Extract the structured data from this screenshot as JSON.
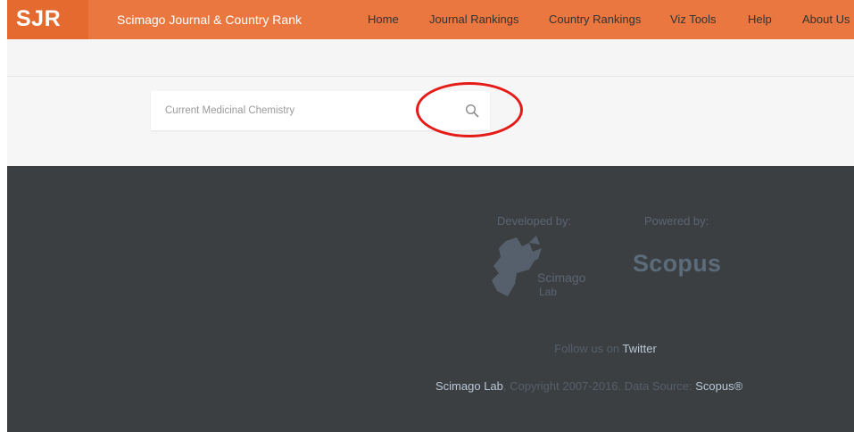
{
  "header": {
    "logo": "SJR",
    "title": "Scimago Journal & Country Rank"
  },
  "nav": {
    "items": [
      "Home",
      "Journal Rankings",
      "Country Rankings",
      "Viz Tools",
      "Help",
      "About Us"
    ]
  },
  "search": {
    "value": "",
    "placeholder": "Current Medicinal Chemistry",
    "button_icon": "search-icon"
  },
  "footer": {
    "developed_by": "Developed by:",
    "powered_by": "Powered by:",
    "scimago_logo_text": "Scimago",
    "scimago_logo_sub": "Lab",
    "scopus_logo_text": "Scopus",
    "follow_prefix": "Follow us on ",
    "follow_link": "Twitter",
    "copyright_link": "Scimago Lab",
    "copyright_text": ", Copyright 2007-2016. Data Source: ",
    "source_link": "Scopus®"
  },
  "colors": {
    "header_orange": "#e9773f",
    "footer_bg": "#3c3f42",
    "highlight_red": "#e41b17"
  }
}
